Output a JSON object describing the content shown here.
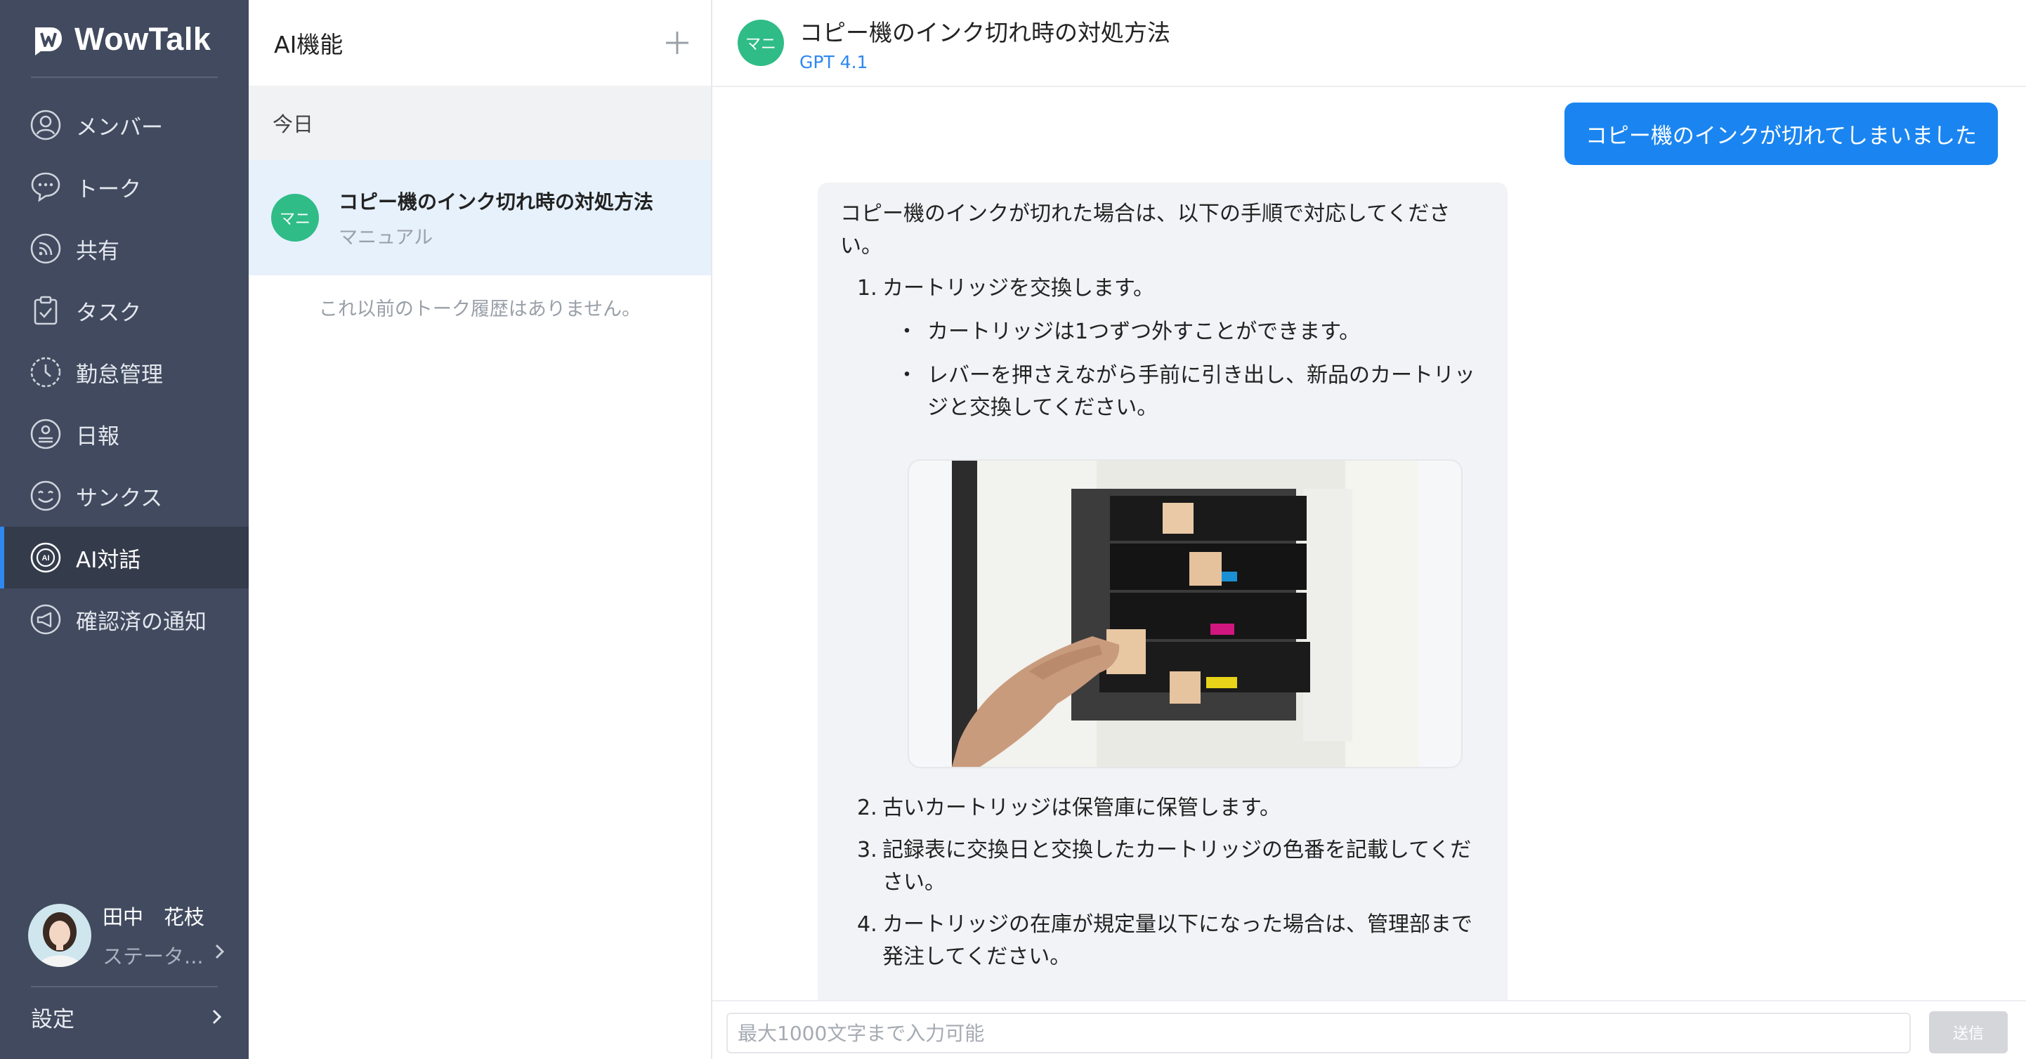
{
  "app": {
    "name": "WowTalk"
  },
  "sidebar": {
    "items": [
      {
        "label": "メンバー",
        "icon": "person-icon",
        "active": false
      },
      {
        "label": "トーク",
        "icon": "chat-bubble-icon",
        "active": false
      },
      {
        "label": "共有",
        "icon": "rss-icon",
        "active": false
      },
      {
        "label": "タスク",
        "icon": "clipboard-icon",
        "active": false
      },
      {
        "label": "勤怠管理",
        "icon": "clock-icon",
        "active": false
      },
      {
        "label": "日報",
        "icon": "report-icon",
        "active": false
      },
      {
        "label": "サンクス",
        "icon": "smile-icon",
        "active": false
      },
      {
        "label": "AI対話",
        "icon": "ai-icon",
        "active": true
      },
      {
        "label": "確認済の通知",
        "icon": "megaphone-icon",
        "active": false
      }
    ],
    "profile": {
      "name": "田中　花枝",
      "status": "ステータ..."
    },
    "settings_label": "設定"
  },
  "conversations": {
    "title": "AI機能",
    "date_group": "今日",
    "items": [
      {
        "badge": "マニ",
        "title": "コピー機のインク切れ時の対処方法",
        "subtitle": "マニュアル"
      }
    ],
    "empty_note": "これ以前のトーク履歴はありません。"
  },
  "chat": {
    "badge": "マニ",
    "title": "コピー機のインク切れ時の対処方法",
    "model": "GPT 4.1",
    "user_message": "コピー機のインクが切れてしまいました",
    "reply": {
      "intro": "コピー機のインクが切れた場合は、以下の手順で対応してください。",
      "steps": [
        {
          "num": "1.",
          "text": "カートリッジを交換します。",
          "bullets": [
            "カートリッジは1つずつ外すことができます。",
            "レバーを押さえながら手前に引き出し、新品のカートリッジと交換してください。"
          ]
        },
        {
          "num": "2.",
          "text": "古いカートリッジは保管庫に保管します。"
        },
        {
          "num": "3.",
          "text": "記録表に交換日と交換したカートリッジの色番を記載してください。"
        },
        {
          "num": "4.",
          "text": "カートリッジの在庫が規定量以下になった場合は、管理部まで発注してください。"
        }
      ],
      "bullet_char": "・"
    },
    "composer": {
      "placeholder": "最大1000文字まで入力可能",
      "send_label": "送信"
    }
  },
  "colors": {
    "sidebar_bg": "#414a5e",
    "sidebar_active_bg": "#343b4b",
    "accent": "#2f87f0",
    "user_bubble": "#1a85f0",
    "badge_green": "#2fbc87",
    "selected_item_bg": "#e6f1fc"
  }
}
